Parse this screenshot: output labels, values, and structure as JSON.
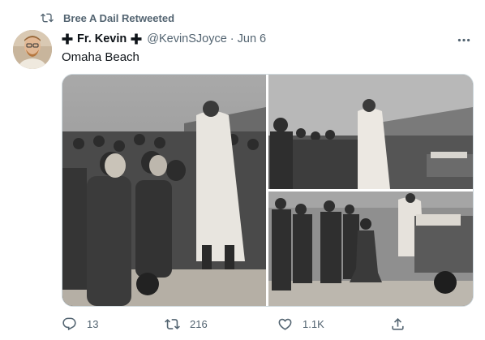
{
  "retweet_banner": {
    "text": "Bree A Dail Retweeted"
  },
  "tweet": {
    "display_name": "Fr. Kevin",
    "handle": "@KevinSJoyce",
    "separator": "·",
    "date": "Jun 6",
    "text": "Omaha Beach"
  },
  "media": {
    "photos": [
      {
        "name": "priest-blessing-kneeling-soldiers"
      },
      {
        "name": "priest-offering-communion-at-altar"
      },
      {
        "name": "soldier-kneeling-before-priest-at-jeep-altar"
      }
    ]
  },
  "actions": {
    "reply_count": "13",
    "retweet_count": "216",
    "like_count": "1.1K"
  },
  "colors": {
    "secondary_text": "#536471",
    "primary_text": "#0f1419",
    "border": "#cfd9de"
  },
  "icons": [
    "retweet-icon",
    "cross-icon",
    "more-icon",
    "reply-icon",
    "like-icon",
    "share-icon"
  ]
}
